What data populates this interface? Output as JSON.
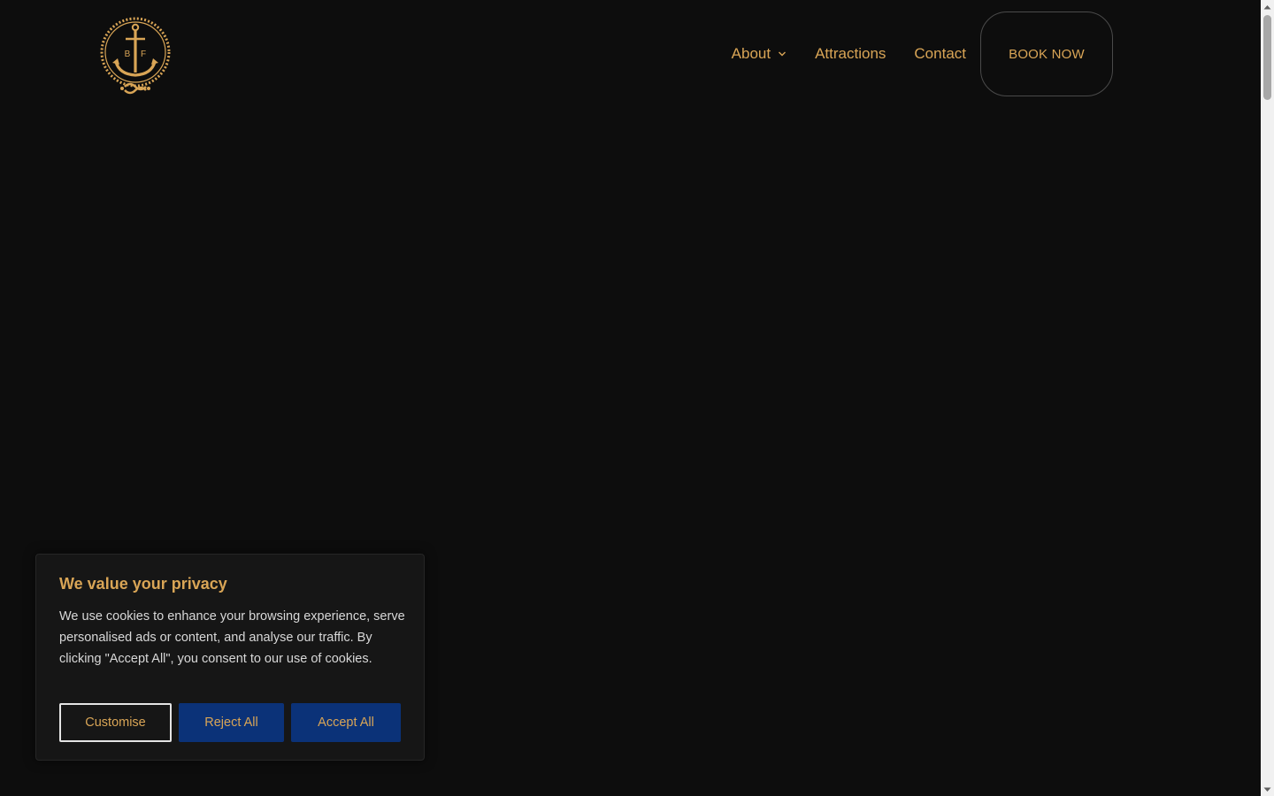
{
  "colors": {
    "background": "#0d0d0d",
    "accent": "#d9a556",
    "banner_background": "#161616",
    "button_blue": "#0b3278",
    "scrollbar_track": "#f1f1f1",
    "scrollbar_thumb": "#a8a8a8"
  },
  "header": {
    "logo": {
      "icon": "anchor-logo-icon",
      "letters_left": "B",
      "letters_right": "F"
    },
    "nav": {
      "about_label": "About",
      "about_icon": "chevron-down-icon",
      "attractions_label": "Attractions",
      "contact_label": "Contact",
      "book_label": "BOOK NOW"
    }
  },
  "cookie_banner": {
    "title": "We value your privacy",
    "text": "We use cookies to enhance your browsing experience, serve personalised ads or content, and analyse our traffic. By clicking \"Accept All\", you consent to our use of cookies.",
    "customise_label": "Customise",
    "reject_label": "Reject All",
    "accept_label": "Accept All"
  },
  "scrollbar": {
    "up_icon": "scroll-up-arrow-icon",
    "down_icon": "scroll-down-arrow-icon"
  }
}
